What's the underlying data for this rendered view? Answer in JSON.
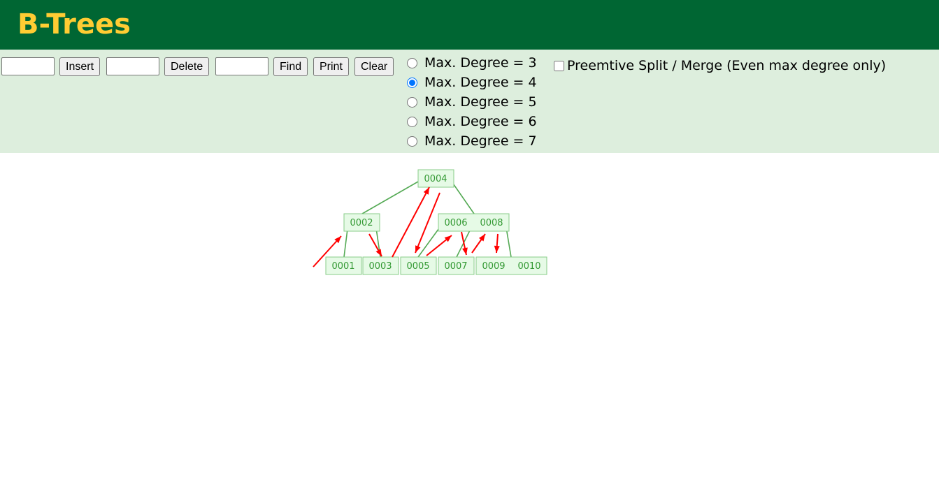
{
  "header": {
    "title": "B-Trees"
  },
  "controls": {
    "insert_label": "Insert",
    "delete_label": "Delete",
    "find_label": "Find",
    "print_label": "Print",
    "clear_label": "Clear",
    "insert_value": "",
    "delete_value": "",
    "find_value": ""
  },
  "degrees": [
    {
      "label": "Max. Degree = 3",
      "checked": false
    },
    {
      "label": "Max. Degree = 4",
      "checked": true
    },
    {
      "label": "Max. Degree = 5",
      "checked": false
    },
    {
      "label": "Max. Degree = 6",
      "checked": false
    },
    {
      "label": "Max. Degree = 7",
      "checked": false
    }
  ],
  "preemptive": {
    "label": "Preemtive Split / Merge (Even max degree only)",
    "checked": false
  },
  "tree": {
    "colors": {
      "node_fill": "#e6fae6",
      "node_stroke": "#88cc88",
      "edge": "#55aa55",
      "text": "#339933",
      "arrow": "#ff0000"
    },
    "nodes": [
      {
        "id": "root",
        "keys": [
          "0004"
        ]
      },
      {
        "id": "l",
        "keys": [
          "0002"
        ]
      },
      {
        "id": "r",
        "keys": [
          "0006",
          "0008"
        ]
      },
      {
        "id": "a",
        "keys": [
          "0001"
        ]
      },
      {
        "id": "b",
        "keys": [
          "0003"
        ]
      },
      {
        "id": "c",
        "keys": [
          "0005"
        ]
      },
      {
        "id": "d",
        "keys": [
          "0007"
        ]
      },
      {
        "id": "e",
        "keys": [
          "0009",
          "0010"
        ]
      }
    ]
  }
}
